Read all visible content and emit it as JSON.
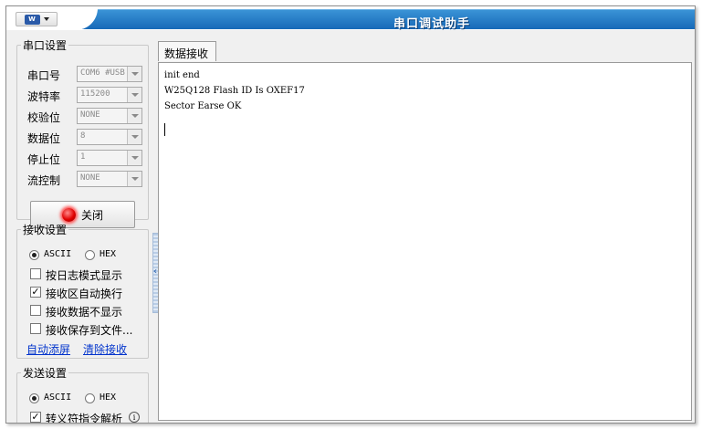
{
  "window": {
    "title": "串口调试助手",
    "app_menu_icon": "app-logo-icon"
  },
  "serial_settings": {
    "legend": "串口设置",
    "port": {
      "label": "串口号",
      "value": "COM6 #USB"
    },
    "baud": {
      "label": "波特率",
      "value": "115200"
    },
    "parity": {
      "label": "校验位",
      "value": "NONE"
    },
    "databits": {
      "label": "数据位",
      "value": "8"
    },
    "stopbits": {
      "label": "停止位",
      "value": "1"
    },
    "flow": {
      "label": "流控制",
      "value": "NONE"
    },
    "toggle_button": {
      "label": "关闭",
      "lamp_color": "#e00000"
    }
  },
  "receive_settings": {
    "legend": "接收设置",
    "mode_ascii": "ASCII",
    "mode_hex": "HEX",
    "selected_mode": "ASCII",
    "options": [
      {
        "label": "按日志模式显示",
        "checked": false
      },
      {
        "label": "接收区自动换行",
        "checked": true
      },
      {
        "label": "接收数据不显示",
        "checked": false
      },
      {
        "label": "接收保存到文件...",
        "checked": false
      }
    ],
    "auto_clear": "自动添屏",
    "clear_receive": "清除接收"
  },
  "send_settings": {
    "legend": "发送设置",
    "mode_ascii": "ASCII",
    "mode_hex": "HEX",
    "selected_mode": "ASCII",
    "escape_option": {
      "label": "转义符指令解析",
      "checked": true
    }
  },
  "receive_panel": {
    "tab": "数据接收",
    "lines": [
      "init end",
      "W25Q128 Flash ID Is OXEF17",
      "Sector Earse OK"
    ]
  },
  "colors": {
    "title_bar": "#1f78c8",
    "link": "#0033cc"
  }
}
